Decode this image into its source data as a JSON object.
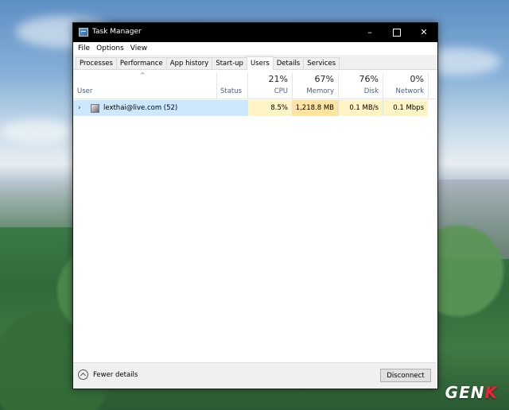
{
  "window": {
    "title": "Task Manager",
    "icon": "task-manager-icon"
  },
  "menu": [
    "File",
    "Options",
    "View"
  ],
  "tabs": [
    {
      "label": "Processes",
      "active": false
    },
    {
      "label": "Performance",
      "active": false
    },
    {
      "label": "App history",
      "active": false
    },
    {
      "label": "Start-up",
      "active": false
    },
    {
      "label": "Users",
      "active": true
    },
    {
      "label": "Details",
      "active": false
    },
    {
      "label": "Services",
      "active": false
    }
  ],
  "columns": {
    "user": "User",
    "status": "Status",
    "cpu": {
      "label": "CPU",
      "percent": "21%"
    },
    "memory": {
      "label": "Memory",
      "percent": "67%"
    },
    "disk": {
      "label": "Disk",
      "percent": "76%"
    },
    "network": {
      "label": "Network",
      "percent": "0%"
    }
  },
  "rows": [
    {
      "user": "lexthai@live.com (52)",
      "status": "",
      "cpu": "8.5%",
      "memory": "1,218.8 MB",
      "disk": "0.1 MB/s",
      "network": "0.1 Mbps"
    }
  ],
  "footer": {
    "fewer_details": "Fewer details",
    "disconnect": "Disconnect"
  },
  "watermark": {
    "text_a": "GEN",
    "text_b": "K"
  },
  "colors": {
    "selection": "#cce8ff",
    "heat_light": "#fff4c4",
    "heat_medium": "#ffe4a0",
    "titlebar": "#000000"
  }
}
